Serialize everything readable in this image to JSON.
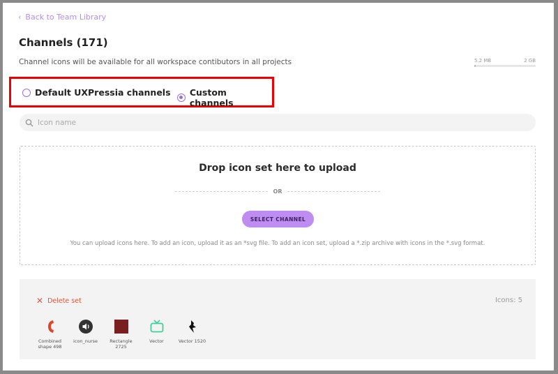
{
  "back_link": {
    "label": "Back to Team Library"
  },
  "page": {
    "title": "Channels (171)",
    "subtitle": "Channel icons will be available for all workspace contibutors in all projects"
  },
  "storage": {
    "used": "5.2 MB",
    "total": "2 GB",
    "fraction": 0.0025
  },
  "channel_source": {
    "options": [
      {
        "label": "Default UXPressia channels",
        "selected": false
      },
      {
        "label": "Custom channels",
        "selected": true
      }
    ]
  },
  "search": {
    "placeholder": "Icon name",
    "value": ""
  },
  "dropzone": {
    "title": "Drop icon set here to upload",
    "or_label": "OR",
    "button_label": "SELECT CHANNEL",
    "help": "You can upload icons here. To add an icon, upload it as an *svg file. To add an icon set, upload a *.zip archive with icons in the *.svg format."
  },
  "icon_set": {
    "delete_label": "Delete set",
    "count_label": "Icons: 5",
    "icons": [
      {
        "name": "Combined shape 498",
        "icon": "phone-icon",
        "color": "#d9472b"
      },
      {
        "name": "icon_nurse",
        "icon": "speaker-icon",
        "color": "#333333"
      },
      {
        "name": "Rectangle 2725",
        "icon": "rectangle-icon",
        "color": "#7a1f1f"
      },
      {
        "name": "Vector",
        "icon": "tv-icon",
        "color": "#3fcf9a"
      },
      {
        "name": "Vector 1520",
        "icon": "bird-icon",
        "color": "#111111"
      }
    ]
  },
  "colors": {
    "accent": "#bf8cf2",
    "highlight_border": "#ee0000",
    "danger": "#e0553c"
  }
}
